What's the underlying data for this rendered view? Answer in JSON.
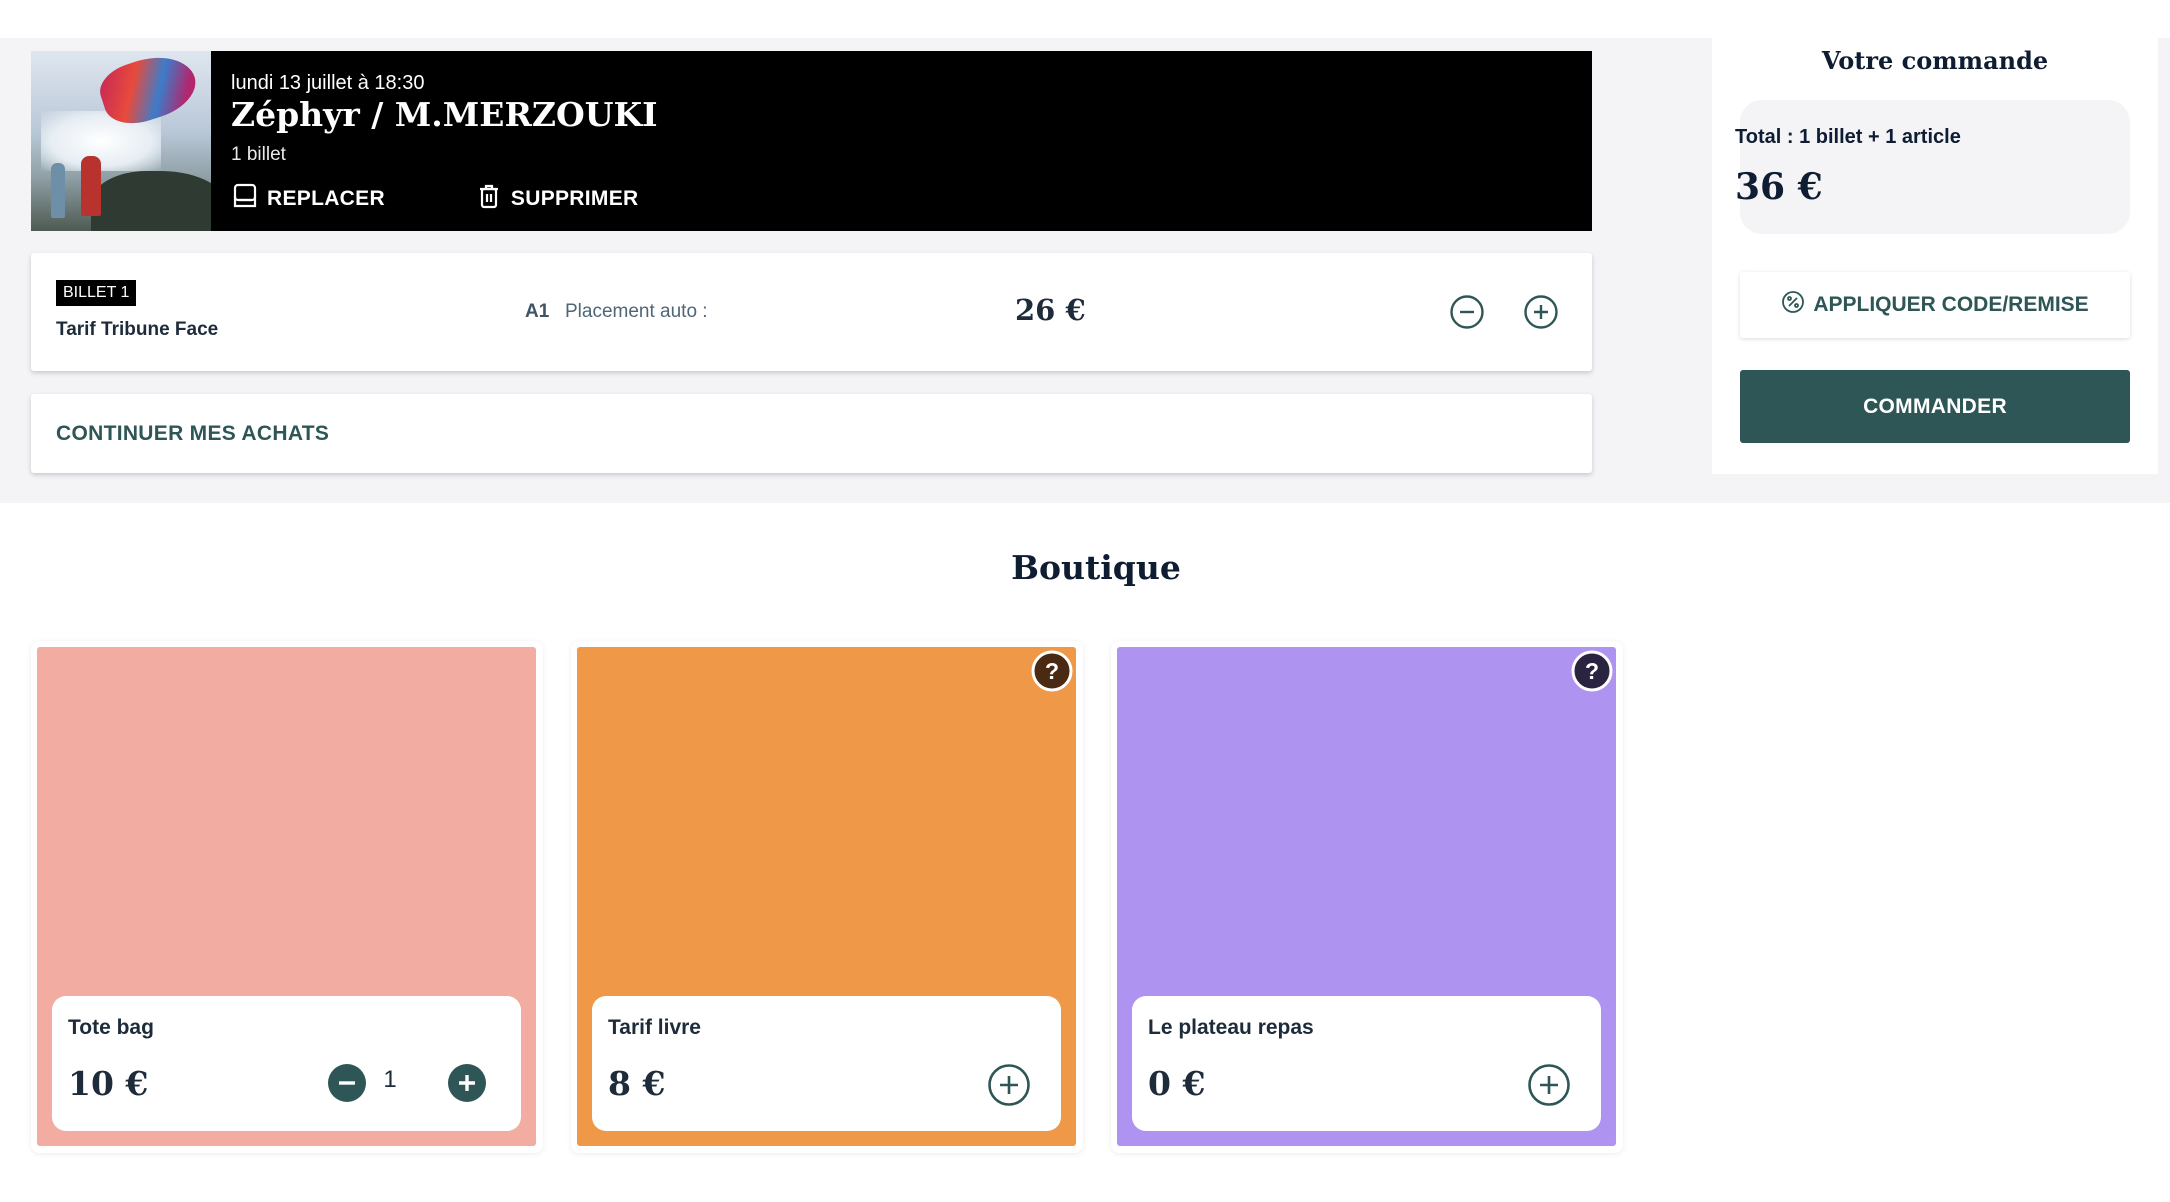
{
  "event": {
    "date": "lundi 13 juillet à 18:30",
    "title": "Zéphyr / M.MERZOUKI",
    "count": "1 billet",
    "replace_label": "REPLACER",
    "delete_label": "SUPPRIMER"
  },
  "ticket": {
    "badge": "BILLET 1",
    "tarif": "Tarif Tribune Face",
    "seat": "A1",
    "placement": "Placement auto :",
    "price": "26 €"
  },
  "continue_label": "CONTINUER MES ACHATS",
  "order": {
    "title": "Votre commande",
    "total_label": "Total : 1 billet + 1 article",
    "total_price": "36 €",
    "code_label": "APPLIQUER CODE/REMISE",
    "order_label": "COMMANDER"
  },
  "boutique": {
    "title": "Boutique",
    "products": [
      {
        "name": "Tote bag",
        "price": "10 €",
        "quantity": "1",
        "color": "#f2aca2"
      },
      {
        "name": "Tarif livre",
        "price": "8 €",
        "color": "#ef9847"
      },
      {
        "name": "Le plateau repas",
        "price": "0 €",
        "color": "#ae94f0"
      }
    ]
  },
  "colors": {
    "accent": "#2f5656",
    "text_dark": "#0f1d33",
    "band_bg": "#f4f3f6"
  }
}
